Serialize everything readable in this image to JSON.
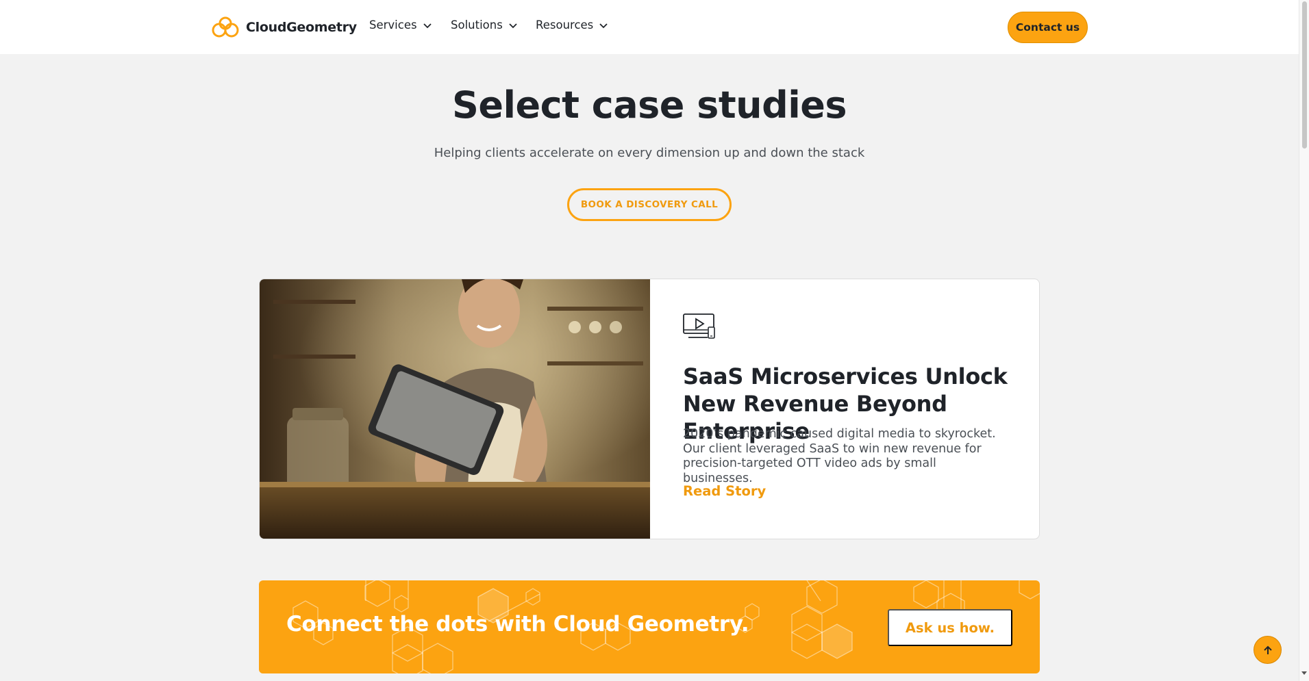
{
  "header": {
    "logo_text": "CloudGeometry",
    "nav": [
      {
        "label": "Services"
      },
      {
        "label": "Solutions"
      },
      {
        "label": "Resources"
      }
    ],
    "contact_label": "Contact us"
  },
  "hero": {
    "title": "Select case studies",
    "subtitle": "Helping clients accelerate on every dimension up and down the stack",
    "cta_label": "BOOK A DISCOVERY CALL"
  },
  "case_study": {
    "icon": "video-screen-icon",
    "title": "SaaS Microservices Unlock New Revenue Beyond Enterprise",
    "description": "2020’s pandemic caused digital media to skyrocket. Our client leveraged SaaS to win new revenue for precision-targeted OTT video ads by small businesses.",
    "link_label": "Read Story"
  },
  "banner": {
    "text": "Connect the dots with Cloud Geometry.",
    "button_label": "Ask us how."
  },
  "colors": {
    "accent": "#fca311",
    "accent_text": "#f09a0e",
    "text": "#1f2329",
    "background": "#f2f2f2"
  }
}
